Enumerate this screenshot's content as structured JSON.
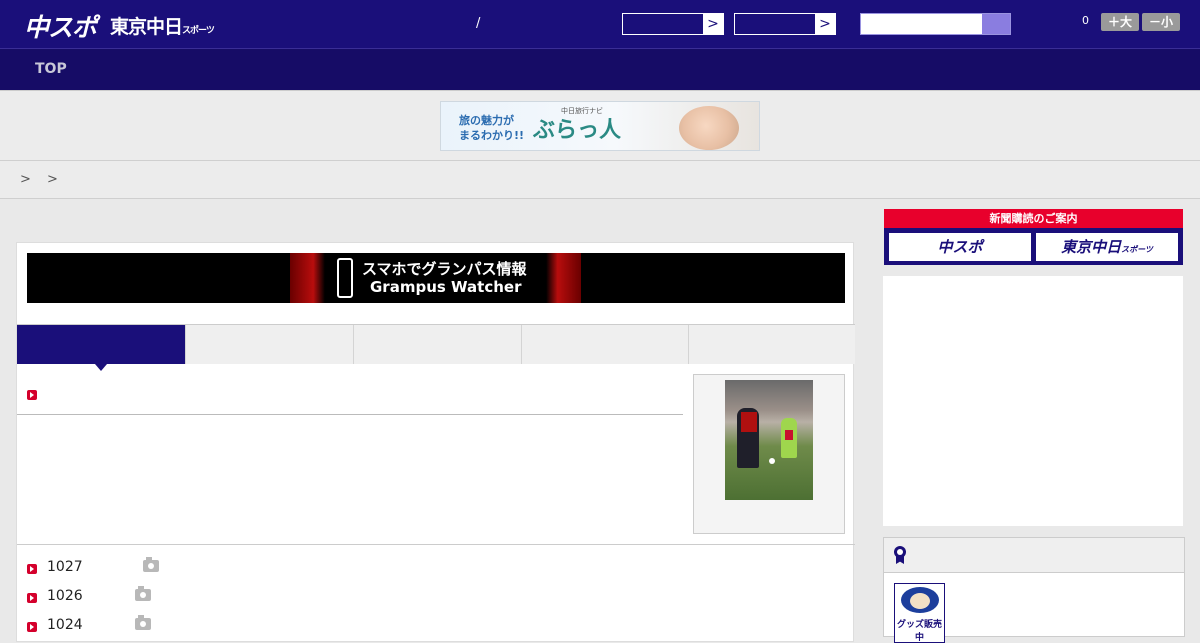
{
  "header": {
    "logo_chuspo": "中スポ",
    "logo_tokyo": "東京中日",
    "logo_sports_small": "スポーツ",
    "date_separator": "/",
    "select_arrow": ">",
    "count": "0",
    "font_up_label": "＋大",
    "font_down_label": "－小"
  },
  "nav": {
    "items": [
      {
        "label": "TOP"
      }
    ]
  },
  "ad_banner": {
    "tagline_1": "旅の魅力が",
    "tagline_2": "まるわかり!!",
    "brand": "ぶらっ人",
    "sub_brand": "中日旅行ナビ"
  },
  "breadcrumb": {
    "text": "> >"
  },
  "grampus_banner": {
    "line1": "スマホでグランパス情報",
    "line2": "Grampus Watcher"
  },
  "news_list": {
    "items": [
      {
        "label": "1027",
        "has_photo": true
      },
      {
        "label": "1026",
        "has_photo": true
      },
      {
        "label": "1024",
        "has_photo": true
      }
    ]
  },
  "sidebar": {
    "subscribe": {
      "header": "新聞購読のご案内",
      "btn_chuspo": "中スポ",
      "btn_tokyo": "東京中日",
      "btn_tokyo_small": "スポーツ"
    },
    "goods_label": "グッズ販売中"
  },
  "colors": {
    "brand_navy": "#1a0f7a",
    "nav_dark": "#160c66",
    "accent_red": "#d4002c",
    "subscribe_red": "#e8002c"
  }
}
